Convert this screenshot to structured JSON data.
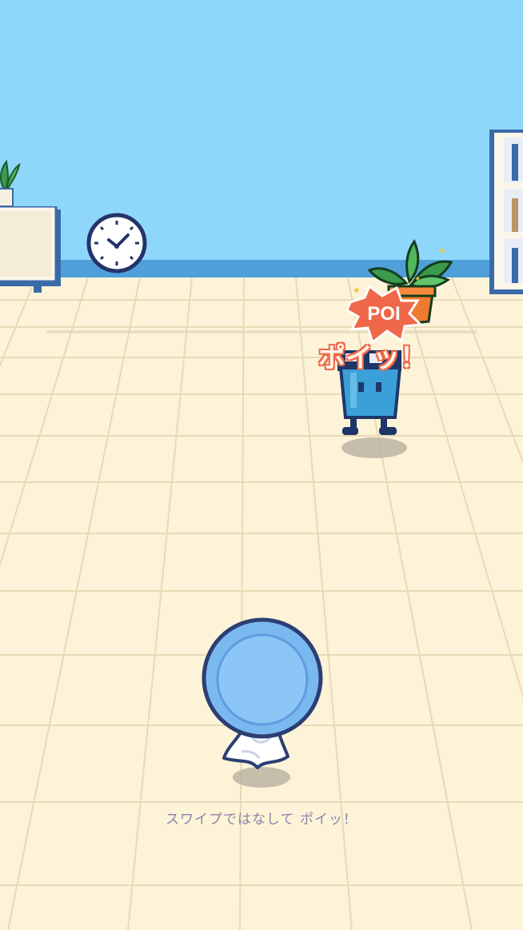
{
  "scene": {
    "name": "office-room",
    "wall_color": "#8ed7fb",
    "baseboard_color": "#4f9fda",
    "floor_color": "#fdf3d8",
    "floor_grid_color": "#e9dcb9"
  },
  "effect": {
    "burst_label": "POI",
    "speech_text": "ポイッ！",
    "accent_color": "#f0684a"
  },
  "hint": {
    "text": "スワイプではなして ポイッ！"
  },
  "characters": {
    "trash_bin": {
      "icon": "trash-bin-character-icon",
      "color": "#3b9fd8"
    },
    "plant": {
      "icon": "potted-plant-icon"
    },
    "player": {
      "icon": "player-ghost-icon",
      "color": "#7ab8f0"
    }
  }
}
